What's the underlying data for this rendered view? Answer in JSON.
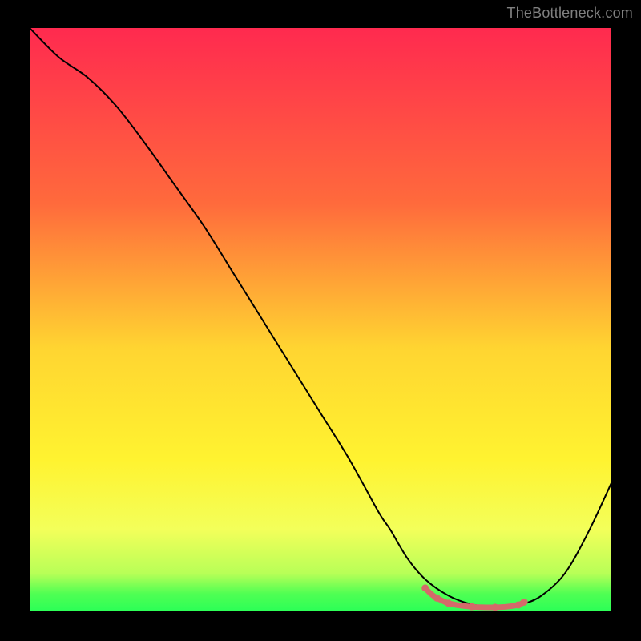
{
  "watermark": "TheBottleneck.com",
  "chart_data": {
    "type": "line",
    "title": "",
    "xlabel": "",
    "ylabel": "",
    "xlim": [
      0,
      100
    ],
    "ylim": [
      0,
      100
    ],
    "grid": false,
    "series": [
      {
        "name": "bottleneck-curve",
        "color": "#000000",
        "x": [
          0,
          5,
          10,
          15,
          20,
          25,
          30,
          35,
          40,
          45,
          50,
          55,
          60,
          62,
          65,
          68,
          72,
          76,
          80,
          83,
          85,
          88,
          92,
          96,
          100
        ],
        "y": [
          100,
          95,
          91.5,
          86.5,
          80,
          73,
          66,
          58,
          50,
          42,
          34,
          26,
          17,
          14,
          9,
          5.5,
          2.7,
          1.2,
          0.7,
          0.8,
          1.3,
          2.7,
          6.5,
          13.5,
          22
        ]
      }
    ],
    "highlight": {
      "name": "plateau-highlight",
      "color": "#d46a6a",
      "x": [
        68,
        69,
        70,
        71,
        72,
        74,
        76,
        78,
        80,
        82,
        84,
        85
      ],
      "y": [
        4,
        3,
        2.3,
        1.8,
        1.4,
        1.0,
        0.8,
        0.7,
        0.7,
        0.8,
        1.1,
        1.6
      ]
    },
    "gradient_stops": [
      {
        "offset": 0.0,
        "color": "#ff2a4f"
      },
      {
        "offset": 0.3,
        "color": "#ff6a3c"
      },
      {
        "offset": 0.55,
        "color": "#ffd531"
      },
      {
        "offset": 0.74,
        "color": "#fff330"
      },
      {
        "offset": 0.86,
        "color": "#f3ff5a"
      },
      {
        "offset": 0.935,
        "color": "#b8ff57"
      },
      {
        "offset": 0.97,
        "color": "#4fff53"
      },
      {
        "offset": 1.0,
        "color": "#2bff57"
      }
    ]
  }
}
